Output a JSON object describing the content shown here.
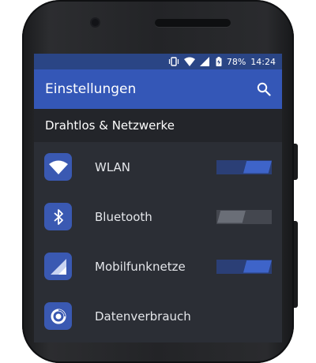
{
  "status_bar": {
    "battery": "78%",
    "time": "14:24",
    "icons": [
      "vibrate-icon",
      "wifi-icon",
      "signal-icon",
      "battery-charging-icon"
    ]
  },
  "app_bar": {
    "title": "Einstellungen",
    "search_icon": "search-icon"
  },
  "section": {
    "title": "Drahtlos & Netzwerke"
  },
  "items": [
    {
      "label": "WLAN",
      "icon": "wifi-icon",
      "toggle": "on"
    },
    {
      "label": "Bluetooth",
      "icon": "bluetooth-icon",
      "toggle": "off"
    },
    {
      "label": "Mobilfunknetze",
      "icon": "cellular-icon",
      "toggle": "on"
    },
    {
      "label": "Datenverbrauch",
      "icon": "data-usage-icon"
    }
  ],
  "colors": {
    "status_bar": "#2a4585",
    "app_bar": "#3457b7",
    "section_bg": "#23252a",
    "list_bg": "#2b2e35",
    "accent": "#3e64c9"
  }
}
